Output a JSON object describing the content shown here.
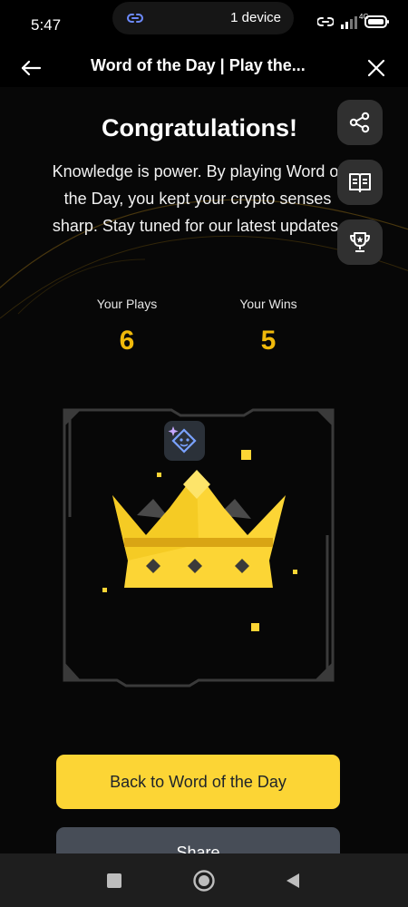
{
  "status_bar": {
    "time": "5:47",
    "pill_text": "1 device",
    "network_label": "4G",
    "icons": [
      "link-icon",
      "hotspot-icon",
      "signal-icon",
      "battery-icon"
    ]
  },
  "app_bar": {
    "title": "Word of the Day | Play the...",
    "back_icon": "arrow-left-icon",
    "close_icon": "close-icon"
  },
  "side_actions": [
    "share-icon",
    "book-icon",
    "trophy-icon"
  ],
  "main": {
    "heading": "Congratulations!",
    "description": "Knowledge is power. By playing Word of the Day, you kept your crypto senses sharp. Stay tuned for our latest updates.",
    "stats": {
      "plays_label": "Your Plays",
      "plays_value": "6",
      "wins_label": "Your Wins",
      "wins_value": "5"
    },
    "badge_icon": "sparkle-face-icon",
    "illustration": "crown"
  },
  "buttons": {
    "primary": "Back to Word of the Day",
    "secondary": "Share"
  },
  "nav_bar": {
    "icons": [
      "recents-icon",
      "home-icon",
      "back-icon"
    ]
  },
  "colors": {
    "accent": "#fcd535",
    "stat_value": "#f0b90b",
    "background": "#070707",
    "secondary_button": "#474d57"
  }
}
